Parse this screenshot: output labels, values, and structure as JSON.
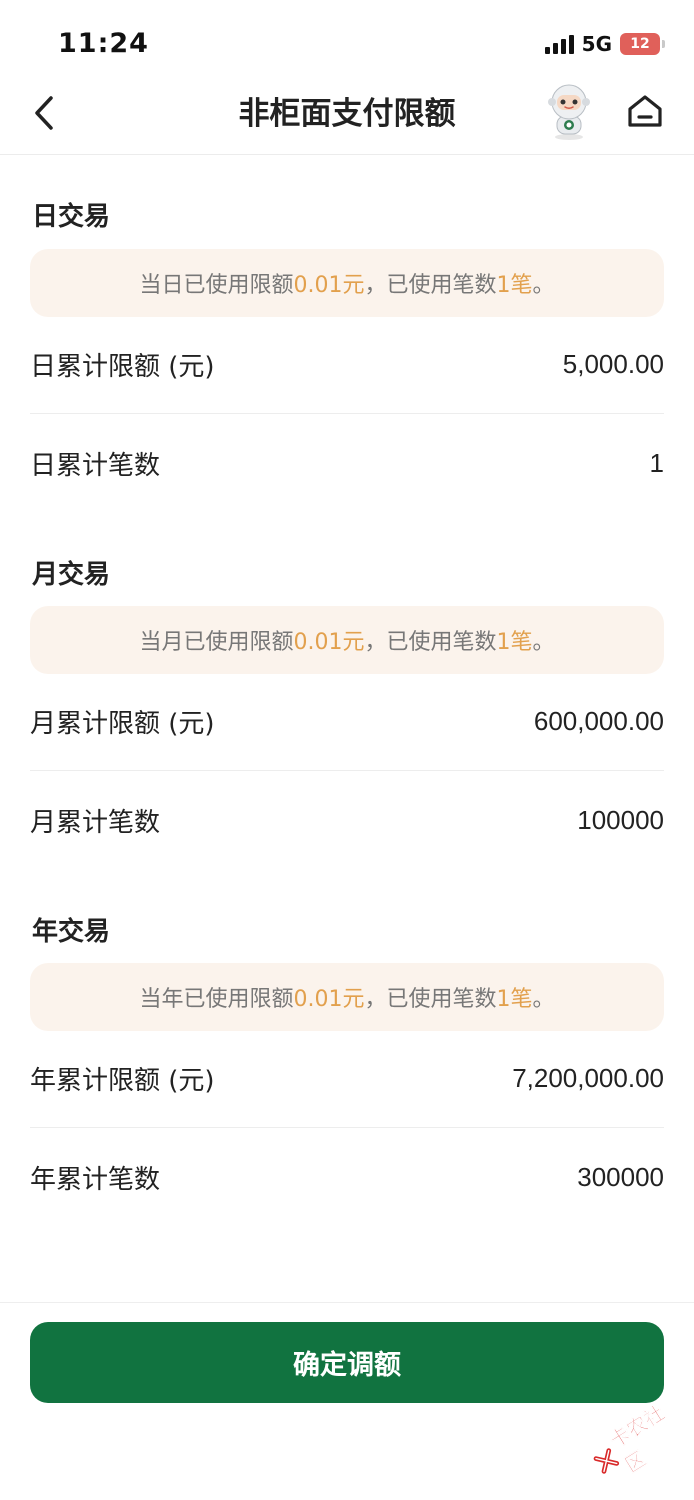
{
  "status_bar": {
    "time": "11:24",
    "network": "5G",
    "battery": "12"
  },
  "nav": {
    "title": "非柜面支付限额"
  },
  "sections": [
    {
      "title": "日交易",
      "notice": {
        "prefix": "当日已使用限额",
        "amount": "0.01元",
        "middle": "，已使用笔数",
        "count": "1笔",
        "suffix": "。"
      },
      "rows": [
        {
          "label": "日累计限额 (元)",
          "value": "5,000.00"
        },
        {
          "label": "日累计笔数",
          "value": "1"
        }
      ]
    },
    {
      "title": "月交易",
      "notice": {
        "prefix": "当月已使用限额",
        "amount": "0.01元",
        "middle": "，已使用笔数",
        "count": "1笔",
        "suffix": "。"
      },
      "rows": [
        {
          "label": "月累计限额 (元)",
          "value": "600,000.00"
        },
        {
          "label": "月累计笔数",
          "value": "100000"
        }
      ]
    },
    {
      "title": "年交易",
      "notice": {
        "prefix": "当年已使用限额",
        "amount": "0.01元",
        "middle": "，已使用笔数",
        "count": "1笔",
        "suffix": "。"
      },
      "rows": [
        {
          "label": "年累计限额 (元)",
          "value": "7,200,000.00"
        },
        {
          "label": "年累计笔数",
          "value": "300000"
        }
      ]
    }
  ],
  "confirm_button": "确定调额",
  "watermark": "卡农社区",
  "colors": {
    "accent_green": "#117340",
    "highlight": "#e2a04d",
    "notice_bg": "#fbf3ec"
  },
  "icons": {
    "back": "chevron-left-icon",
    "home": "home-icon",
    "assistant": "robot-assistant-icon"
  }
}
